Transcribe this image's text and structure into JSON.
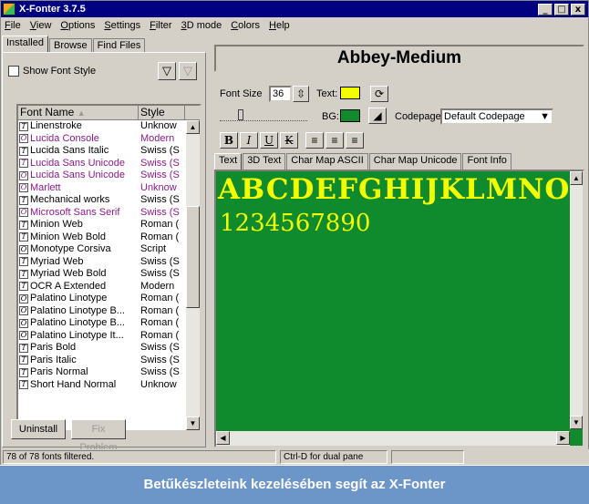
{
  "window": {
    "title": "X-Fonter 3.7.5",
    "controls": [
      "_",
      "□",
      "x"
    ]
  },
  "menu": [
    "File",
    "View",
    "Options",
    "Settings",
    "Filter",
    "3D mode",
    "Colors",
    "Help"
  ],
  "left": {
    "tabs": [
      "Installed",
      "Browse",
      "Find Files"
    ],
    "show_font_style": "Show Font Style",
    "columns": [
      "Font Name",
      "Style"
    ],
    "fonts": [
      {
        "name": "Linenstroke",
        "style": "Unknow",
        "type": "T",
        "color": "#000000"
      },
      {
        "name": "Lucida Console",
        "style": "Modern",
        "type": "O",
        "color": "#8b1a8b"
      },
      {
        "name": "Lucida Sans Italic",
        "style": "Swiss (S",
        "type": "T",
        "color": "#000000"
      },
      {
        "name": "Lucida Sans Unicode",
        "style": "Swiss (S",
        "type": "T",
        "color": "#8b1a8b"
      },
      {
        "name": "Lucida Sans Unicode",
        "style": "Swiss (S",
        "type": "O",
        "color": "#8b1a8b"
      },
      {
        "name": "Marlett",
        "style": "Unknow",
        "type": "O",
        "color": "#8b1a8b"
      },
      {
        "name": "Mechanical works",
        "style": "Swiss (S",
        "type": "T",
        "color": "#000000"
      },
      {
        "name": "Microsoft Sans Serif",
        "style": "Swiss (S",
        "type": "O",
        "color": "#8b1a8b"
      },
      {
        "name": "Minion Web",
        "style": "Roman (",
        "type": "T",
        "color": "#000000"
      },
      {
        "name": "Minion Web Bold",
        "style": "Roman (",
        "type": "T",
        "color": "#000000"
      },
      {
        "name": "Monotype Corsiva",
        "style": "Script",
        "type": "O",
        "color": "#000000"
      },
      {
        "name": "Myriad Web",
        "style": "Swiss (S",
        "type": "T",
        "color": "#000000"
      },
      {
        "name": "Myriad Web Bold",
        "style": "Swiss (S",
        "type": "T",
        "color": "#000000"
      },
      {
        "name": "OCR A Extended",
        "style": "Modern",
        "type": "T",
        "color": "#000000"
      },
      {
        "name": "Palatino Linotype",
        "style": "Roman (",
        "type": "O",
        "color": "#000000"
      },
      {
        "name": "Palatino Linotype B...",
        "style": "Roman (",
        "type": "O",
        "color": "#000000"
      },
      {
        "name": "Palatino Linotype B...",
        "style": "Roman (",
        "type": "O",
        "color": "#000000"
      },
      {
        "name": "Palatino Linotype It...",
        "style": "Roman (",
        "type": "O",
        "color": "#000000"
      },
      {
        "name": "Paris Bold",
        "style": "Swiss (S",
        "type": "T",
        "color": "#000000"
      },
      {
        "name": "Paris Italic",
        "style": "Swiss (S",
        "type": "T",
        "color": "#000000"
      },
      {
        "name": "Paris Normal",
        "style": "Swiss (S",
        "type": "T",
        "color": "#000000"
      },
      {
        "name": "Short Hand Normal",
        "style": "Unknow",
        "type": "T",
        "color": "#000000"
      }
    ],
    "uninstall": "Uninstall",
    "fix_problem": "Fix Problem"
  },
  "right": {
    "font_name": "Abbey-Medium",
    "font_size_label": "Font Size",
    "font_size": "36",
    "text_label": "Text:",
    "bg_label": "BG:",
    "text_color": "#f1ff00",
    "bg_color": "#0f8a2c",
    "codepage_label": "Codepage",
    "codepage": "Default Codepage",
    "format_buttons": [
      "B",
      "I",
      "U",
      "K"
    ],
    "align_buttons": [
      "≡",
      "≡",
      "≡"
    ],
    "tabs": [
      "Text",
      "3D Text",
      "Char Map ASCII",
      "Char Map Unicode",
      "Font Info"
    ],
    "sample_line1": "ABCDEFGHIJKLMNOPQRSTU",
    "sample_line2": "1234567890"
  },
  "status": {
    "count": "78 of 78 fonts filtered.",
    "hint": "Ctrl-D for dual pane"
  },
  "caption": "Betűkészleteink kezelésében segít az X-Fonter"
}
